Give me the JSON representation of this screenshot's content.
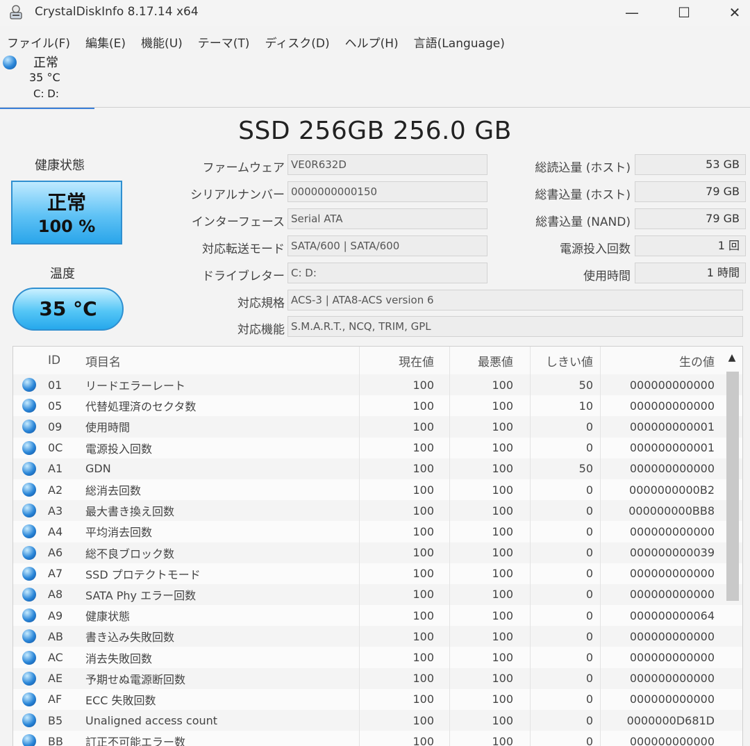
{
  "window": {
    "title": "CrystalDiskInfo 8.17.14 x64",
    "min_glyph": "—",
    "max_glyph": "☐",
    "close_glyph": "✕"
  },
  "menu": [
    "ファイル(F)",
    "編集(E)",
    "機能(U)",
    "テーマ(T)",
    "ディスク(D)",
    "ヘルプ(H)",
    "言語(Language)"
  ],
  "disk_tab": {
    "status": "正常",
    "temp": "35 °C",
    "drives": "C: D:",
    "status_color": "#2a86d8"
  },
  "drive_title": "SSD 256GB 256.0 GB",
  "health": {
    "label": "健康状態",
    "status": "正常",
    "percent": "100 %",
    "color": "#5fc2f5"
  },
  "temperature": {
    "label": "温度",
    "value": "35 °C"
  },
  "info": {
    "firmware_label": "ファームウェア",
    "firmware": "VE0R632D",
    "serial_label": "シリアルナンバー",
    "serial": "0000000000150",
    "interface_label": "インターフェース",
    "interface": "Serial ATA",
    "transfer_label": "対応転送モード",
    "transfer": "SATA/600 | SATA/600",
    "letter_label": "ドライブレター",
    "letter": "C: D:",
    "standard_label": "対応規格",
    "standard": "ACS-3 | ATA8-ACS version 6",
    "features_label": "対応機能",
    "features": "S.M.A.R.T., NCQ, TRIM, GPL",
    "host_reads_label": "総読込量 (ホスト)",
    "host_reads": "53 GB",
    "host_writes_label": "総書込量 (ホスト)",
    "host_writes": "79 GB",
    "nand_writes_label": "総書込量 (NAND)",
    "nand_writes": "79 GB",
    "power_count_label": "電源投入回数",
    "power_count": "1 回",
    "power_hours_label": "使用時間",
    "power_hours": "1 時間"
  },
  "smart": {
    "headers": {
      "id": "ID",
      "name": "項目名",
      "current": "現在値",
      "worst": "最悪値",
      "threshold": "しきい値",
      "raw": "生の値"
    },
    "rows": [
      {
        "id": "01",
        "name": "リードエラーレート",
        "current": "100",
        "worst": "100",
        "threshold": "50",
        "raw": "000000000000"
      },
      {
        "id": "05",
        "name": "代替処理済のセクタ数",
        "current": "100",
        "worst": "100",
        "threshold": "10",
        "raw": "000000000000"
      },
      {
        "id": "09",
        "name": "使用時間",
        "current": "100",
        "worst": "100",
        "threshold": "0",
        "raw": "000000000001"
      },
      {
        "id": "0C",
        "name": "電源投入回数",
        "current": "100",
        "worst": "100",
        "threshold": "0",
        "raw": "000000000001"
      },
      {
        "id": "A1",
        "name": "GDN",
        "current": "100",
        "worst": "100",
        "threshold": "50",
        "raw": "000000000000"
      },
      {
        "id": "A2",
        "name": "総消去回数",
        "current": "100",
        "worst": "100",
        "threshold": "0",
        "raw": "0000000000B2"
      },
      {
        "id": "A3",
        "name": "最大書き換え回数",
        "current": "100",
        "worst": "100",
        "threshold": "0",
        "raw": "000000000BB8"
      },
      {
        "id": "A4",
        "name": "平均消去回数",
        "current": "100",
        "worst": "100",
        "threshold": "0",
        "raw": "000000000000"
      },
      {
        "id": "A6",
        "name": "総不良ブロック数",
        "current": "100",
        "worst": "100",
        "threshold": "0",
        "raw": "000000000039"
      },
      {
        "id": "A7",
        "name": "SSD プロテクトモード",
        "current": "100",
        "worst": "100",
        "threshold": "0",
        "raw": "000000000000"
      },
      {
        "id": "A8",
        "name": "SATA Phy エラー回数",
        "current": "100",
        "worst": "100",
        "threshold": "0",
        "raw": "000000000000"
      },
      {
        "id": "A9",
        "name": "健康状態",
        "current": "100",
        "worst": "100",
        "threshold": "0",
        "raw": "000000000064"
      },
      {
        "id": "AB",
        "name": "書き込み失敗回数",
        "current": "100",
        "worst": "100",
        "threshold": "0",
        "raw": "000000000000"
      },
      {
        "id": "AC",
        "name": "消去失敗回数",
        "current": "100",
        "worst": "100",
        "threshold": "0",
        "raw": "000000000000"
      },
      {
        "id": "AE",
        "name": "予期せぬ電源断回数",
        "current": "100",
        "worst": "100",
        "threshold": "0",
        "raw": "000000000000"
      },
      {
        "id": "AF",
        "name": "ECC 失敗回数",
        "current": "100",
        "worst": "100",
        "threshold": "0",
        "raw": "000000000000"
      },
      {
        "id": "B5",
        "name": "Unaligned access count",
        "current": "100",
        "worst": "100",
        "threshold": "0",
        "raw": "0000000D681D"
      },
      {
        "id": "BB",
        "name": "訂正不可能エラー数",
        "current": "100",
        "worst": "100",
        "threshold": "0",
        "raw": "000000000000"
      }
    ]
  },
  "icons": {
    "app": "crystaldiskinfo-icon",
    "status_dot": "status-good-icon",
    "scroll_up": "▲"
  }
}
